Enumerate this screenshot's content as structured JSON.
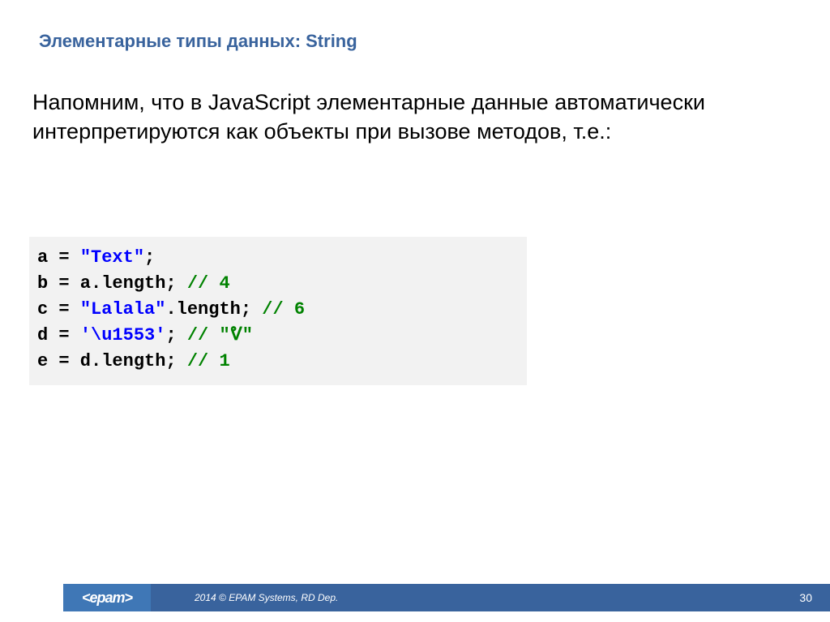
{
  "title": "Элементарные типы данных: String",
  "body": "Напомним, что в JavaScript элементарные данные автоматически интерпретируются как объекты при вызове методов, т.е.:",
  "code": {
    "l1a": "a = ",
    "l1s": "\"Text\"",
    "l1b": ";",
    "l2a": "b = a.length; ",
    "l2c": "// 4",
    "l3a": "c = ",
    "l3s": "\"Lalala\"",
    "l3b": ".length; ",
    "l3c": "// 6",
    "l4a": "d = ",
    "l4s": "'\\u1553'",
    "l4b": "; ",
    "l4c": "// \"ᕓ\"",
    "l5a": "e = d.length; ",
    "l5c": "// 1"
  },
  "footer": {
    "logo": "<epam>",
    "copyright": "2014 © EPAM Systems, RD Dep.",
    "page": "30"
  }
}
